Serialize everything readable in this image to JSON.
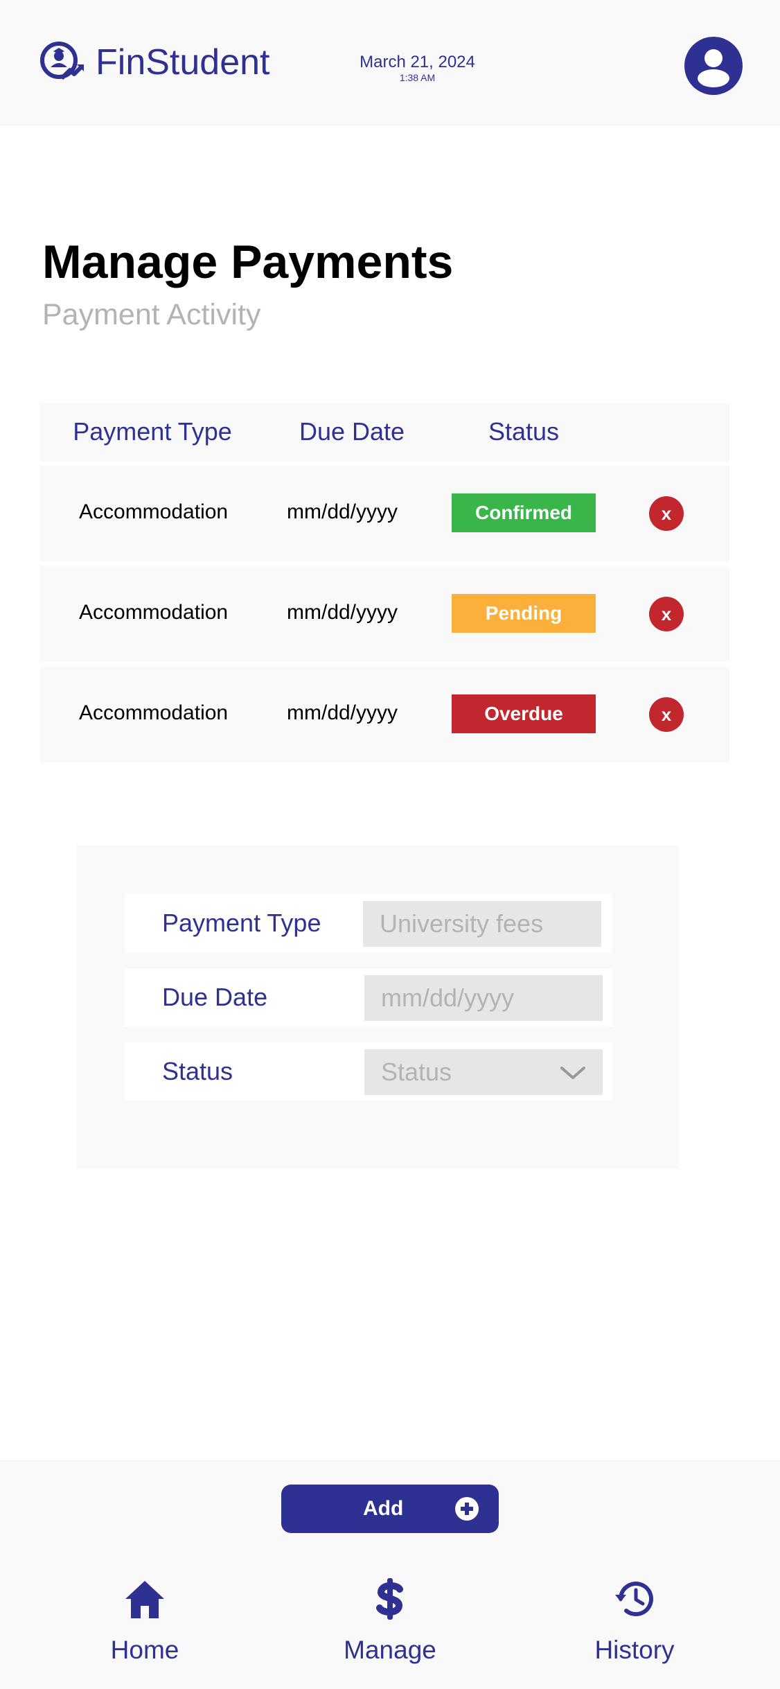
{
  "header": {
    "brand": "FinStudent",
    "date": "March 21, 2024",
    "time": "1:38 AM",
    "logo_icon": "graduate-growth-icon",
    "avatar_icon": "user-icon"
  },
  "page": {
    "title": "Manage Payments",
    "subtitle": "Payment Activity"
  },
  "table": {
    "columns": [
      "Payment Type",
      "Due Date",
      "Status"
    ],
    "rows": [
      {
        "type": "Accommodation",
        "due": "mm/dd/yyyy",
        "status": "Confirmed",
        "status_color": "#39b54a",
        "delete": "x"
      },
      {
        "type": "Accommodation",
        "due": "mm/dd/yyyy",
        "status": "Pending",
        "status_color": "#fbb03b",
        "delete": "x"
      },
      {
        "type": "Accommodation",
        "due": "mm/dd/yyyy",
        "status": "Overdue",
        "status_color": "#c1272d",
        "delete": "x"
      }
    ]
  },
  "form": {
    "payment_type": {
      "label": "Payment Type",
      "placeholder": "University fees"
    },
    "due_date": {
      "label": "Due Date",
      "placeholder": "mm/dd/yyyy"
    },
    "status": {
      "label": "Status",
      "placeholder": "Status"
    }
  },
  "actions": {
    "add_label": "Add",
    "add_icon": "plus-circle-icon"
  },
  "nav": {
    "items": [
      {
        "label": "Home",
        "icon": "home-icon"
      },
      {
        "label": "Manage",
        "icon": "dollar-icon"
      },
      {
        "label": "History",
        "icon": "history-icon"
      }
    ]
  },
  "colors": {
    "primary": "#2e3192",
    "panel": "#f9f9f9",
    "delete": "#c1272d"
  }
}
